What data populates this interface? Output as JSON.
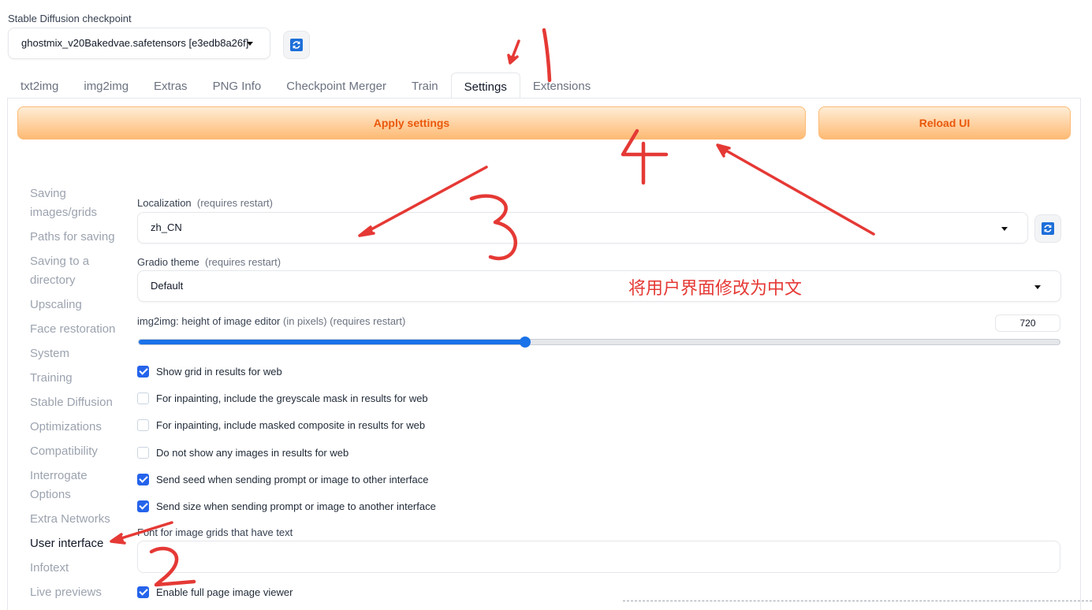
{
  "checkpoint": {
    "label": "Stable Diffusion checkpoint",
    "selected": "ghostmix_v20Bakedvae.safetensors [e3edb8a26f]"
  },
  "tabs": [
    "txt2img",
    "img2img",
    "Extras",
    "PNG Info",
    "Checkpoint Merger",
    "Train",
    "Settings",
    "Extensions"
  ],
  "active_tab": "Settings",
  "buttons": {
    "apply": "Apply settings",
    "reload": "Reload UI"
  },
  "sidebar": {
    "items": [
      {
        "label": "Saving images/grids"
      },
      {
        "label": "Paths for saving"
      },
      {
        "label": "Saving to a directory"
      },
      {
        "label": "Upscaling"
      },
      {
        "label": "Face restoration"
      },
      {
        "label": "System"
      },
      {
        "label": "Training"
      },
      {
        "label": "Stable Diffusion"
      },
      {
        "label": "Optimizations"
      },
      {
        "label": "Compatibility"
      },
      {
        "label": "Interrogate Options"
      },
      {
        "label": "Extra Networks"
      },
      {
        "label": "User interface"
      },
      {
        "label": "Infotext"
      },
      {
        "label": "Live previews"
      }
    ],
    "selected": "User interface"
  },
  "settings": {
    "localization": {
      "label": "Localization",
      "hint": "(requires restart)",
      "value": "zh_CN"
    },
    "gradio_theme": {
      "label": "Gradio theme",
      "hint": "(requires restart)",
      "value": "Default"
    },
    "img_editor_height": {
      "label": "img2img: height of image editor",
      "hint": "(in pixels) (requires restart)",
      "value": "720",
      "fill_fraction": 0.42
    },
    "checkboxes": [
      {
        "label": "Show grid in results for web",
        "checked": true
      },
      {
        "label": "For inpainting, include the greyscale mask in results for web",
        "checked": false
      },
      {
        "label": "For inpainting, include masked composite in results for web",
        "checked": false
      },
      {
        "label": "Do not show any images in results for web",
        "checked": false
      },
      {
        "label": "Send seed when sending prompt or image to other interface",
        "checked": true
      },
      {
        "label": "Send size when sending prompt or image to another interface",
        "checked": true
      }
    ],
    "font_field": {
      "label": "Font for image grids that have text",
      "value": ""
    },
    "full_page_viewer": {
      "label": "Enable full page image viewer",
      "checked": true
    }
  },
  "annotation": {
    "text": "将用户界面修改为中文",
    "numbers": [
      "1",
      "2",
      "3",
      "4"
    ],
    "color": "#e53935"
  },
  "colors": {
    "accent": "#2563eb",
    "orange_button": "#ea580c",
    "slider": "#1a73e8"
  }
}
